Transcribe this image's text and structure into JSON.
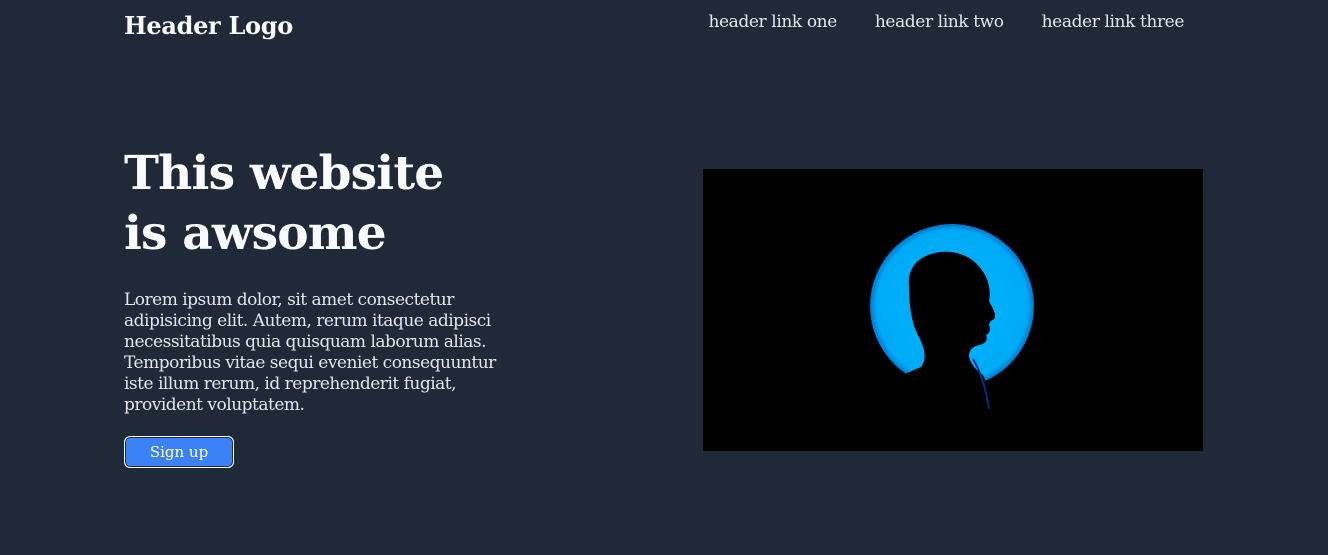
{
  "header": {
    "logo": "Header Logo",
    "links": [
      "header link one",
      "header link two",
      "header link three"
    ]
  },
  "hero": {
    "title": "This website is awsome",
    "body": "Lorem ipsum dolor, sit amet consectetur adipisicing elit. Autem, rerum itaque adipisci necessitatibus quia quisquam laborum alias. Temporibus vitae sequi eveniet consequuntur iste illum rerum, id reprehenderit fugiat, provident voluptatem.",
    "signup_label": "Sign up",
    "image_icon": "silhouette-image"
  },
  "colors": {
    "background": "#1f2937",
    "button": "#3b82f6",
    "image_glow": "#00aeff"
  }
}
